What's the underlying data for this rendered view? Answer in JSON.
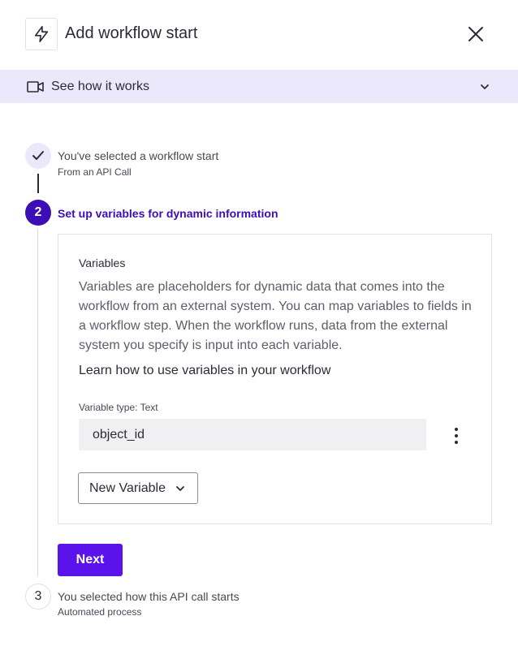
{
  "header": {
    "title": "Add workflow start",
    "icon": "lightning-icon",
    "close_icon": "close-icon"
  },
  "howto": {
    "label": "See how it works",
    "icon": "video-camera-icon",
    "expand_icon": "chevron-down-icon"
  },
  "steps": [
    {
      "marker": "check-icon",
      "title": "You've selected a workflow start",
      "subtitle": "From an API Call",
      "state": "completed"
    },
    {
      "marker": "2",
      "title": "Set up variables for dynamic information",
      "state": "active"
    },
    {
      "marker": "3",
      "title": "You selected how this API call starts",
      "subtitle": "Automated process",
      "state": "pending"
    }
  ],
  "variables_card": {
    "heading": "Variables",
    "description": "Variables are placeholders for dynamic data that comes into the workflow from an external system. You can map variables to fields in a workflow step. When the workflow runs, data from the external system you specify is input into each variable.",
    "learn_link": "Learn how to use variables in your workflow",
    "variable_type_label": "Variable type: Text",
    "variable_value": "object_id",
    "more_icon": "kebab-menu-icon",
    "new_variable_label": "New Variable"
  },
  "next_label": "Next",
  "colors": {
    "accent": "#5b13ec",
    "active_step": "#3b0fb5",
    "banner_bg": "#ebe8fb"
  }
}
